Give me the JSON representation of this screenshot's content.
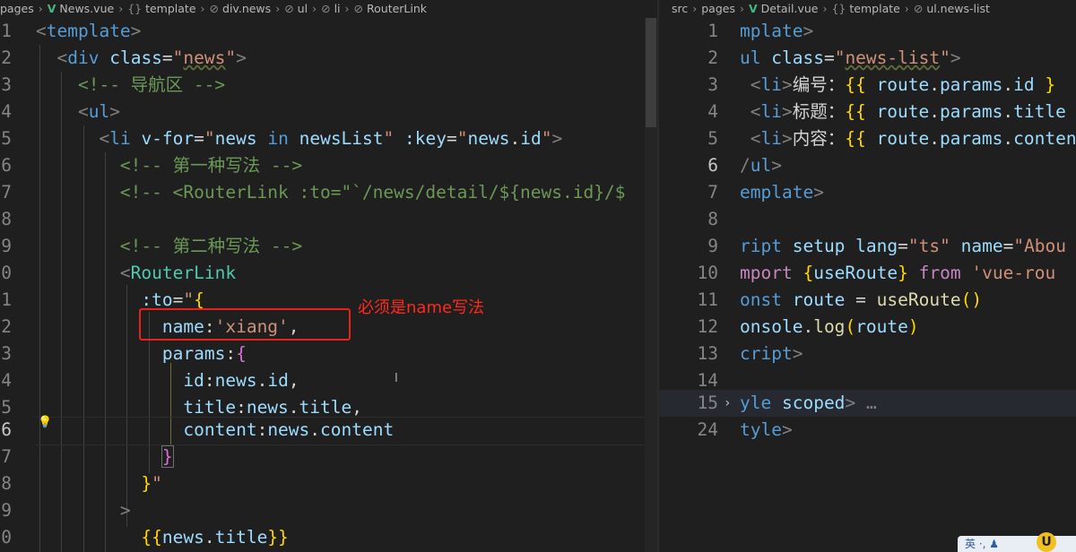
{
  "left_editor": {
    "breadcrumb": [
      "pages",
      "News.vue",
      "template",
      "div.news",
      "ul",
      "li",
      "RouterLink"
    ],
    "line_numbers": [
      "1",
      "2",
      "3",
      "4",
      "5",
      "6",
      "7",
      "8",
      "9",
      "0",
      "1",
      "2",
      "3",
      "4",
      "5",
      "6",
      "7",
      "8",
      "9",
      "0"
    ],
    "annotation": "必须是name写法",
    "highlight_text": "name:'xiang',"
  },
  "right_editor": {
    "breadcrumb": [
      "src",
      "pages",
      "Detail.vue",
      "template",
      "ul.news-list"
    ],
    "line_numbers": [
      "1",
      "2",
      "3",
      "4",
      "5",
      "6",
      "7",
      "8",
      "9",
      "10",
      "11",
      "12",
      "13",
      "14",
      "15",
      "24"
    ],
    "folded_text": "…"
  },
  "tray": {
    "ime": "英",
    "extra": "·, ♟",
    "badge": "U"
  },
  "colors": {
    "annotation": "#ff2a1a",
    "highlight_border": "#e8221b",
    "tag": "#569cd6",
    "string": "#ce9178",
    "attribute": "#9cdcfe",
    "comment": "#6a9955"
  },
  "icons": [
    "vue-file-icon",
    "braces-icon",
    "element-icon",
    "lightbulb-icon",
    "fold-chevron-icon"
  ]
}
